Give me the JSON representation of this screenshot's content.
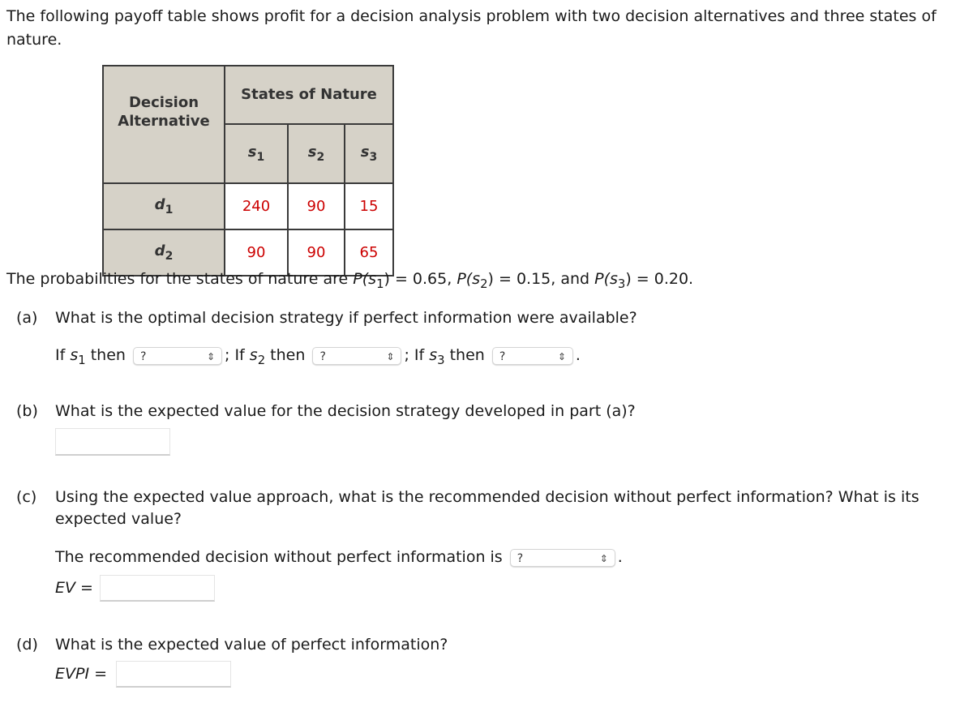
{
  "intro": "The following payoff table shows profit for a decision analysis problem with two decision alternatives and three states of nature.",
  "table": {
    "decision_header_line1": "Decision",
    "decision_header_line2": "Alternative",
    "states_header": "States of Nature",
    "states": [
      {
        "base": "s",
        "sub": "1"
      },
      {
        "base": "s",
        "sub": "2"
      },
      {
        "base": "s",
        "sub": "3"
      }
    ],
    "rows": [
      {
        "base": "d",
        "sub": "1",
        "values": [
          "240",
          "90",
          "15"
        ]
      },
      {
        "base": "d",
        "sub": "2",
        "values": [
          "90",
          "90",
          "65"
        ]
      }
    ],
    "value_color": "#cc0000"
  },
  "probabilities": {
    "prefix": "The probabilities for the states of nature are ",
    "p1_label": "P(s",
    "p1_sub": "1",
    "p1_value": ") = 0.65, ",
    "p2_label": "P(s",
    "p2_sub": "2",
    "p2_value": ") = 0.15, and ",
    "p3_label": "P(s",
    "p3_sub": "3",
    "p3_value": ") = 0.20."
  },
  "part_a": {
    "label": "(a)",
    "question": "What is the optimal decision strategy if perfect information were available?",
    "if_text": "If ",
    "then_text": " then",
    "sep": "; If ",
    "end": ".",
    "s_base": "s",
    "subs": [
      "1",
      "2",
      "3"
    ],
    "dropdowns": [
      "?",
      "?",
      "?"
    ]
  },
  "part_b": {
    "label": "(b)",
    "question": "What is the expected value for the decision strategy developed in part (a)?",
    "answer_value": ""
  },
  "part_c": {
    "label": "(c)",
    "question_line1": "Using the expected value approach, what is the recommended decision without perfect information? What is its",
    "question_line2": "expected value?",
    "recommend_text": "The recommended decision without perfect information is",
    "dropdown": "?",
    "end": ".",
    "ev_label": "EV",
    "equals": " =",
    "ev_value": ""
  },
  "part_d": {
    "label": "(d)",
    "question": "What is the expected value of perfect information?",
    "evpi_label": "EVPI",
    "equals": " =",
    "evpi_value": ""
  },
  "icons": {
    "dropdown_arrow": "⇕"
  }
}
